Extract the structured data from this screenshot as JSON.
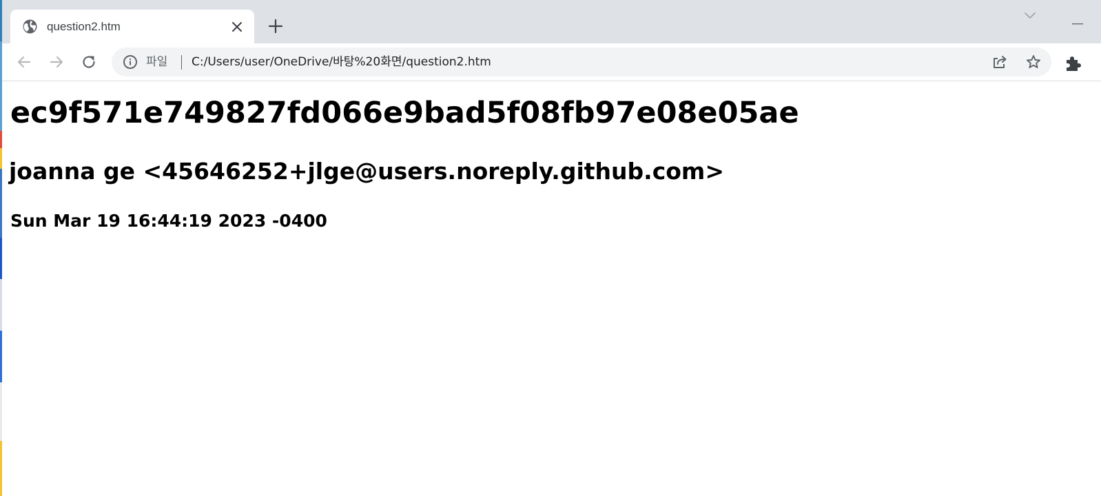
{
  "browser": {
    "tab": {
      "title": "question2.htm",
      "favicon_icon": "globe-icon",
      "close_icon": "close-icon"
    },
    "new_tab_icon": "plus-icon",
    "tab_search_icon": "chevron-down-icon",
    "window_minimize_icon": "minimize-icon",
    "toolbar": {
      "back_icon": "arrow-left-icon",
      "forward_icon": "arrow-right-icon",
      "reload_icon": "reload-icon",
      "site_info_icon": "info-icon",
      "scheme_label": "파일",
      "url": "C:/Users/user/OneDrive/바탕%20화면/question2.htm",
      "share_icon": "share-icon",
      "bookmark_icon": "star-icon",
      "extensions_icon": "puzzle-icon"
    }
  },
  "page": {
    "heading1": "ec9f571e749827fd066e9bad5f08fb97e08e05ae",
    "heading2": "joanna ge <45646252+jlge@users.noreply.github.com>",
    "heading3": "Sun Mar 19 16:44:19 2023 -0400"
  },
  "colors": {
    "tab_strip": "#dee1e6",
    "omnibox": "#f1f3f4",
    "icon": "#5f6368",
    "text": "#000000"
  }
}
